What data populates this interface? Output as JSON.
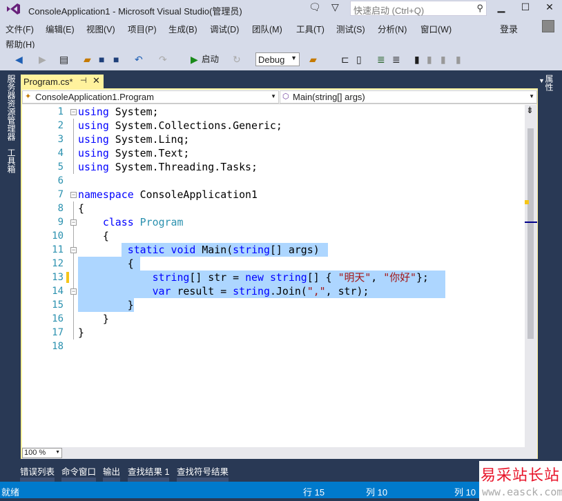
{
  "window": {
    "title": "ConsoleApplication1 - Microsoft Visual Studio(管理员)",
    "quick_launch_placeholder": "快速启动 (Ctrl+Q)"
  },
  "menu": [
    "文件(F)",
    "编辑(E)",
    "视图(V)",
    "项目(P)",
    "生成(B)",
    "调试(D)",
    "团队(M)",
    "工具(T)",
    "测试(S)",
    "分析(N)",
    "窗口(W)",
    "帮助(H)"
  ],
  "login": "登录",
  "toolbar": {
    "start": "启动",
    "config": "Debug"
  },
  "side_left": [
    "服务器资源管理器",
    "工具箱"
  ],
  "side_right": "属性",
  "doc_tab": {
    "label": "Program.cs*"
  },
  "nav": {
    "class": "ConsoleApplication1.Program",
    "member": "Main(string[] args)"
  },
  "code": [
    [
      [
        "using",
        "kw"
      ],
      [
        " System;",
        "pl"
      ]
    ],
    [
      [
        "using",
        "kw"
      ],
      [
        " System.Collections.Generic;",
        "pl"
      ]
    ],
    [
      [
        "using",
        "kw"
      ],
      [
        " System.Linq;",
        "pl"
      ]
    ],
    [
      [
        "using",
        "kw"
      ],
      [
        " System.Text;",
        "pl"
      ]
    ],
    [
      [
        "using",
        "kw"
      ],
      [
        " System.Threading.Tasks;",
        "pl"
      ]
    ],
    [],
    [
      [
        "namespace",
        "kw"
      ],
      [
        " ConsoleApplication1",
        "pl"
      ]
    ],
    [
      [
        "{",
        "pl"
      ]
    ],
    [
      [
        "    ",
        "pl"
      ],
      [
        "class",
        "kw"
      ],
      [
        " ",
        "pl"
      ],
      [
        "Program",
        "ty"
      ]
    ],
    [
      [
        "    {",
        "pl"
      ]
    ],
    [
      [
        "        ",
        "pl"
      ],
      [
        "static",
        "kw"
      ],
      [
        " ",
        "pl"
      ],
      [
        "void",
        "kw"
      ],
      [
        " Main(",
        "pl"
      ],
      [
        "string",
        "kw"
      ],
      [
        "[] args)",
        "pl"
      ]
    ],
    [
      [
        "        {",
        "pl"
      ]
    ],
    [
      [
        "            ",
        "pl"
      ],
      [
        "string",
        "kw"
      ],
      [
        "[] str = ",
        "pl"
      ],
      [
        "new",
        "kw"
      ],
      [
        " ",
        "pl"
      ],
      [
        "string",
        "kw"
      ],
      [
        "[] { ",
        "pl"
      ],
      [
        "\"明天\"",
        "st"
      ],
      [
        ", ",
        "pl"
      ],
      [
        "\"你好\"",
        "st"
      ],
      [
        "};",
        "pl"
      ]
    ],
    [
      [
        "            ",
        "pl"
      ],
      [
        "var",
        "kw"
      ],
      [
        " result = ",
        "pl"
      ],
      [
        "string",
        "kw"
      ],
      [
        ".Join(",
        "pl"
      ],
      [
        "\",\"",
        "st"
      ],
      [
        ", str);",
        "pl"
      ]
    ],
    [
      [
        "        }",
        "pl"
      ]
    ],
    [
      [
        "    }",
        "pl"
      ]
    ],
    [
      [
        "}",
        "pl"
      ]
    ],
    []
  ],
  "zoom": "100 %",
  "bottom_tabs": [
    "错误列表",
    "命令窗口",
    "输出",
    "查找结果 1",
    "查找符号结果"
  ],
  "status": {
    "ready": "就绪",
    "line": "行 15",
    "col": "列 10",
    "ch": "列 10"
  },
  "watermark": {
    "cn": "易采站长站",
    "url": "www.easck.com"
  },
  "colors": {
    "accent": "#007acc",
    "tab": "#fff29d",
    "selection": "#add6ff"
  }
}
